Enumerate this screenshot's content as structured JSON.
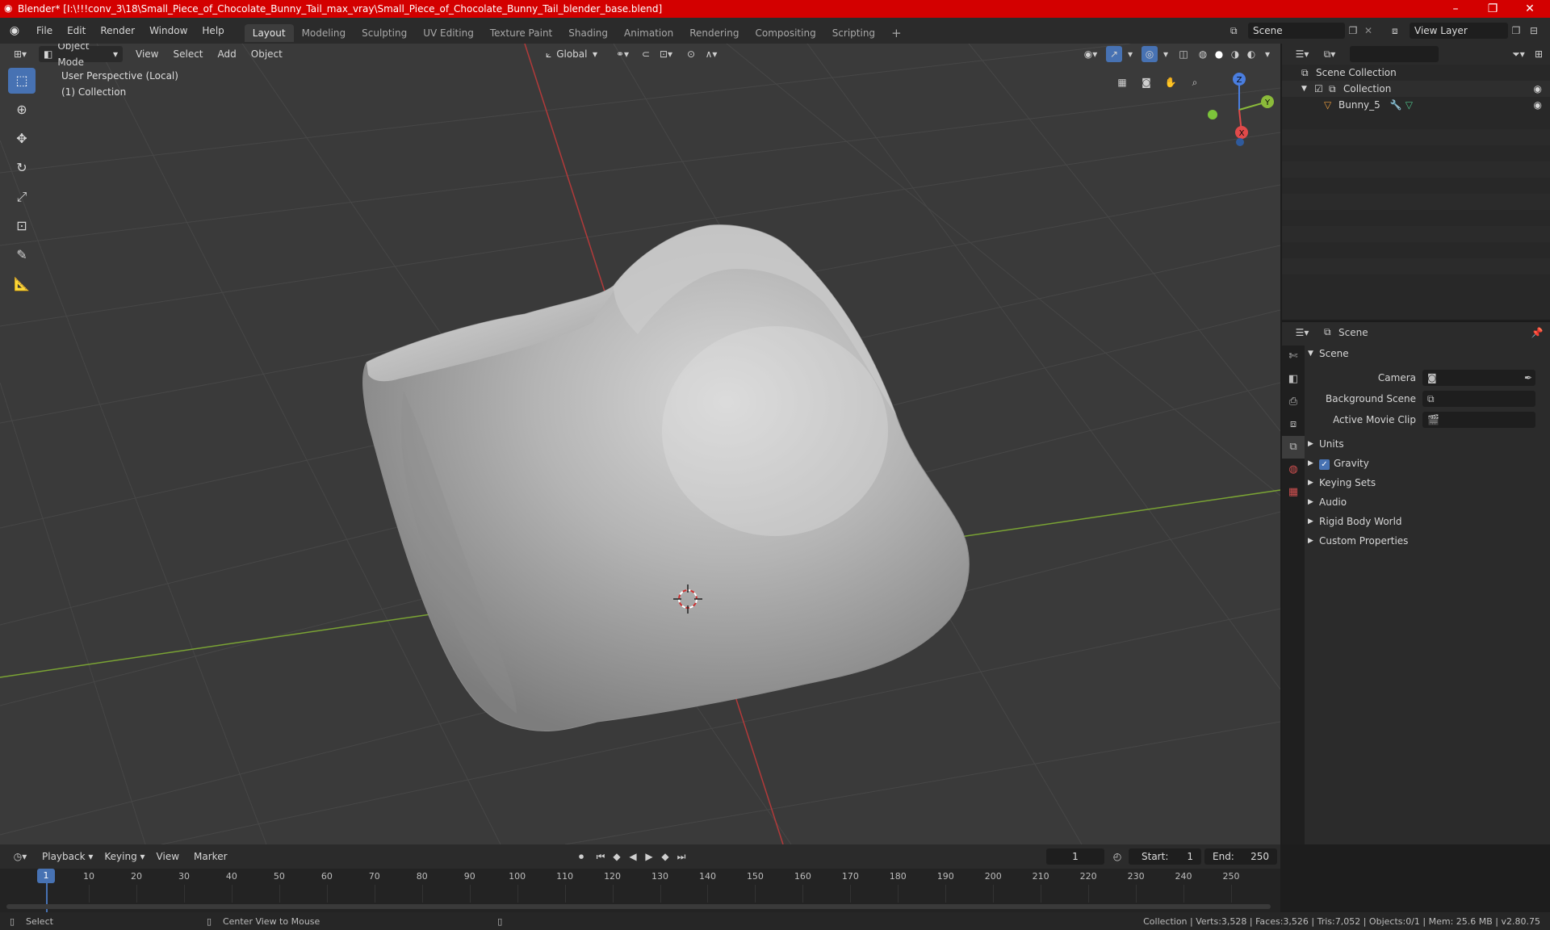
{
  "window": {
    "title": "Blender* [I:\\!!!conv_3\\18\\Small_Piece_of_Chocolate_Bunny_Tail_max_vray\\Small_Piece_of_Chocolate_Bunny_Tail_blender_base.blend]"
  },
  "menu": [
    "File",
    "Edit",
    "Render",
    "Window",
    "Help"
  ],
  "workspaces": [
    "Layout",
    "Modeling",
    "Sculpting",
    "UV Editing",
    "Texture Paint",
    "Shading",
    "Animation",
    "Rendering",
    "Compositing",
    "Scripting"
  ],
  "active_workspace": "Layout",
  "scene_name": "Scene",
  "view_layer": "View Layer",
  "viewport": {
    "mode": "Object Mode",
    "menus": [
      "View",
      "Select",
      "Add",
      "Object"
    ],
    "transform_orientation": "Global",
    "info_line1": "User Perspective (Local)",
    "info_line2": "(1) Collection",
    "gizmo": {
      "z": "Z",
      "y": "Y",
      "x": "X"
    }
  },
  "outliner": {
    "search_placeholder": "",
    "items": [
      {
        "label": "Scene Collection",
        "depth": 0
      },
      {
        "label": "Collection",
        "depth": 1
      },
      {
        "label": "Bunny_5",
        "depth": 2
      }
    ]
  },
  "properties": {
    "context": "Scene",
    "section": "Scene",
    "fields": [
      {
        "label": "Camera",
        "value": ""
      },
      {
        "label": "Background Scene",
        "value": ""
      },
      {
        "label": "Active Movie Clip",
        "value": ""
      }
    ],
    "panels": [
      {
        "label": "Units",
        "checkbox": false
      },
      {
        "label": "Gravity",
        "checkbox": true
      },
      {
        "label": "Keying Sets",
        "checkbox": false
      },
      {
        "label": "Audio",
        "checkbox": false
      },
      {
        "label": "Rigid Body World",
        "checkbox": false
      },
      {
        "label": "Custom Properties",
        "checkbox": false
      }
    ]
  },
  "timeline": {
    "menus": [
      "Playback",
      "Keying",
      "View",
      "Marker"
    ],
    "current_frame": "1",
    "start_label": "Start:",
    "start": "1",
    "end_label": "End:",
    "end": "250",
    "ruler": [
      "1",
      "10",
      "20",
      "30",
      "40",
      "50",
      "60",
      "70",
      "80",
      "90",
      "100",
      "110",
      "120",
      "130",
      "140",
      "150",
      "160",
      "170",
      "180",
      "190",
      "200",
      "210",
      "220",
      "230",
      "240",
      "250"
    ]
  },
  "status": {
    "left": "Select",
    "middle": "Center View to Mouse",
    "right": "Collection | Verts:3,528 | Faces:3,526 | Tris:7,052 | Objects:0/1 | Mem: 25.6 MB | v2.80.75"
  },
  "colors": {
    "title_bar": "#d30000",
    "accent": "#4772b3",
    "x_axis": "#e04a4a",
    "y_axis": "#8bbb3a",
    "z_axis": "#4a7ee0"
  }
}
